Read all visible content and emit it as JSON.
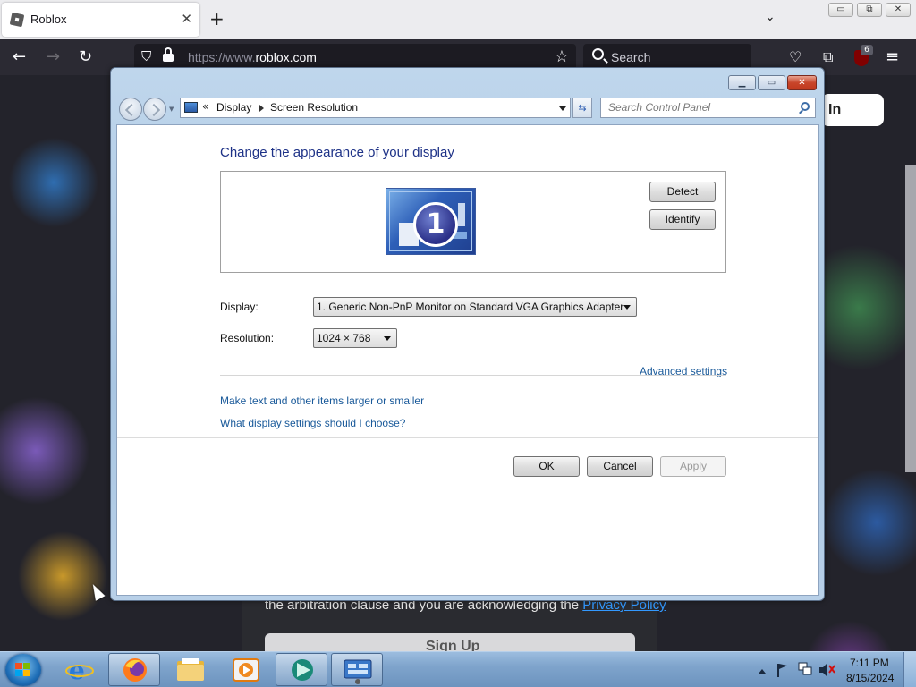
{
  "browser": {
    "tab_title": "Roblox",
    "tab_close": "✕",
    "new_tab": "+",
    "tab_list": "⌄",
    "window_min": "▭",
    "window_restore": "⧉",
    "window_close": "✕",
    "url_scheme": "https://www.",
    "url_host": "roblox.com",
    "search_placeholder": "Search",
    "extensions_badge": "6"
  },
  "page": {
    "login_partial": "In",
    "legal_text": "the arbitration clause and you are acknowledging the",
    "privacy_link": "Privacy Policy",
    "signup_label": "Sign Up"
  },
  "control_panel": {
    "breadcrumb": [
      "Display",
      "Screen Resolution"
    ],
    "breadcrumb_chevron": "«",
    "search_placeholder": "Search Control Panel",
    "heading": "Change the appearance of your display",
    "monitor_number": "1",
    "detect_button": "Detect",
    "identify_button": "Identify",
    "display_label": "Display:",
    "display_value": "1. Generic Non-PnP Monitor on Standard VGA Graphics Adapter",
    "resolution_label": "Resolution:",
    "resolution_value": "1024 × 768",
    "advanced_link": "Advanced settings",
    "text_size_link": "Make text and other items larger or smaller",
    "help_link": "What display settings should I choose?",
    "ok_button": "OK",
    "cancel_button": "Cancel",
    "apply_button": "Apply"
  },
  "taskbar": {
    "time": "7:11 PM",
    "date": "8/15/2024",
    "apps": [
      "internet-explorer",
      "firefox",
      "file-explorer",
      "media-player",
      "app-green",
      "control-panel"
    ]
  }
}
